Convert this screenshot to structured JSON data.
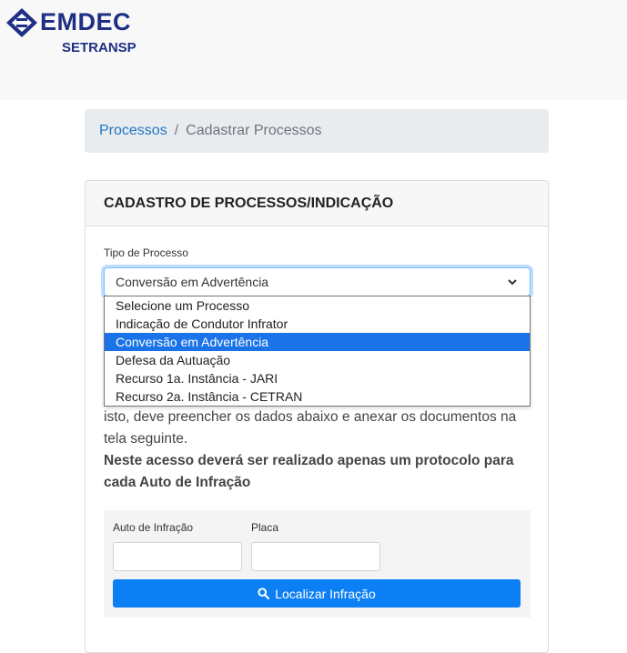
{
  "brand": {
    "name": "EMDEC",
    "subtitle": "SETRANSP",
    "color": "#1e2f84"
  },
  "breadcrumb": {
    "link": "Processos",
    "separator": "/",
    "current": "Cadastrar Processos"
  },
  "card": {
    "title": "CADASTRO DE PROCESSOS/INDICAÇÃO"
  },
  "tipo_processo": {
    "label": "Tipo de Processo",
    "selected": "Conversão em Advertência",
    "options": [
      "Selecione um Processo",
      "Indicação de Condutor Infrator",
      "Conversão em Advertência",
      "Defesa da Autuação",
      "Recurso 1a. Instância - JARI",
      "Recurso 2a. Instância - CETRAN"
    ],
    "highlighted_index": 2
  },
  "instructions": {
    "text": "isto, deve preencher os dados abaixo e anexar os documentos na tela seguinte.",
    "bold_text": "Neste acesso deverá ser realizado apenas um protocolo para cada Auto de Infração"
  },
  "search": {
    "auto_label": "Auto de Infração",
    "auto_value": "",
    "placa_label": "Placa",
    "placa_value": "",
    "button_label": "Localizar Infração",
    "button_icon": "search-icon",
    "button_color": "#0d7ff5"
  }
}
